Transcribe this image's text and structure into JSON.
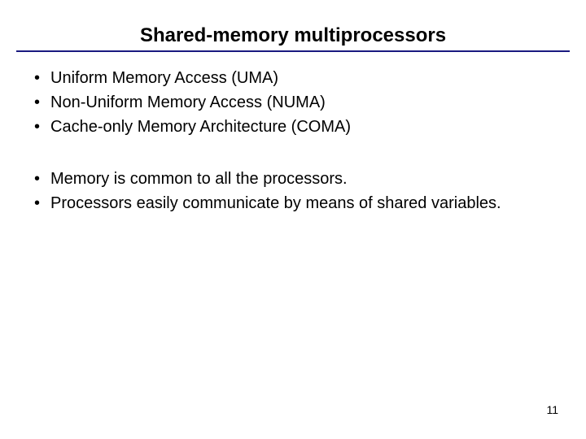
{
  "title": "Shared-memory multiprocessors",
  "group1": [
    "Uniform Memory Access (UMA)",
    "Non-Uniform Memory Access (NUMA)",
    "Cache-only Memory Architecture (COMA)"
  ],
  "group2": [
    "Memory is common to all the processors.",
    "Processors easily communicate by means of shared variables."
  ],
  "page_number": "11"
}
